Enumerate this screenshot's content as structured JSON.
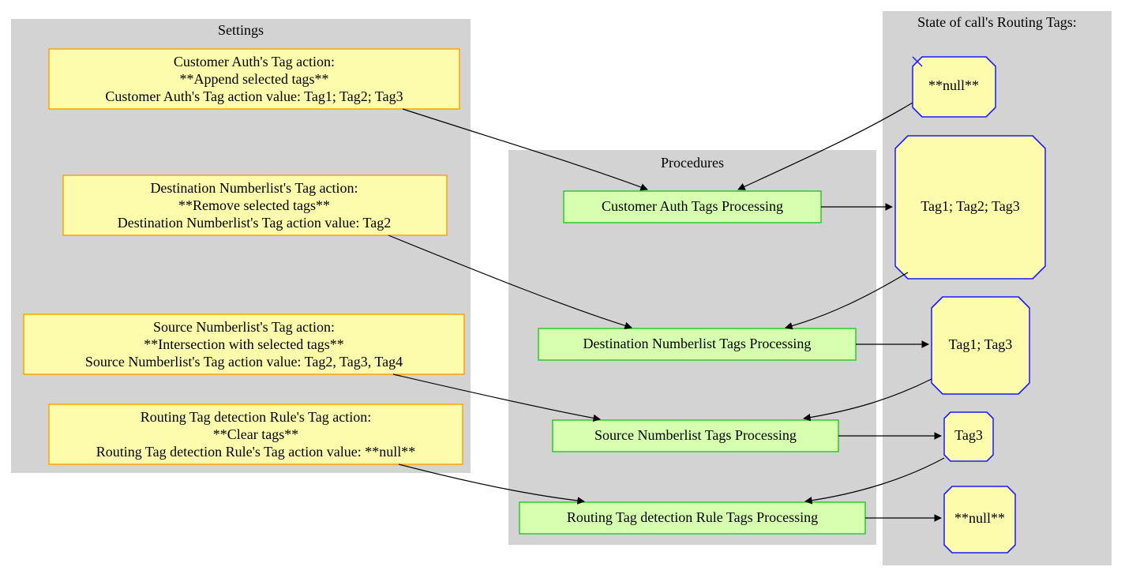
{
  "settings": {
    "title": "Settings",
    "nodes": [
      {
        "line1": "Customer Auth's Tag action:",
        "line2": "**Append selected tags**",
        "line3": "Customer Auth's Tag action value: Tag1; Tag2; Tag3"
      },
      {
        "line1": "Destination Numberlist's Tag action:",
        "line2": "**Remove selected tags**",
        "line3": "Destination Numberlist's Tag action value: Tag2"
      },
      {
        "line1": "Source Numberlist's Tag action:",
        "line2": "**Intersection with selected tags**",
        "line3": "Source Numberlist's Tag action value: Tag2, Tag3, Tag4"
      },
      {
        "line1": "Routing Tag detection Rule's Tag action:",
        "line2": "**Clear tags**",
        "line3": "Routing Tag detection Rule's Tag action value: **null**"
      }
    ]
  },
  "procedures": {
    "title": "Procedures",
    "nodes": [
      {
        "label": "Customer Auth Tags Processing"
      },
      {
        "label": "Destination Numberlist Tags Processing"
      },
      {
        "label": "Source Numberlist Tags Processing"
      },
      {
        "label": "Routing Tag detection Rule Tags Processing"
      }
    ]
  },
  "state": {
    "title": "State of call's Routing Tags:",
    "nodes": [
      {
        "label": "**null**"
      },
      {
        "label": "Tag1; Tag2; Tag3"
      },
      {
        "label": "Tag1; Tag3"
      },
      {
        "label": "Tag3"
      },
      {
        "label": "**null**"
      }
    ]
  }
}
